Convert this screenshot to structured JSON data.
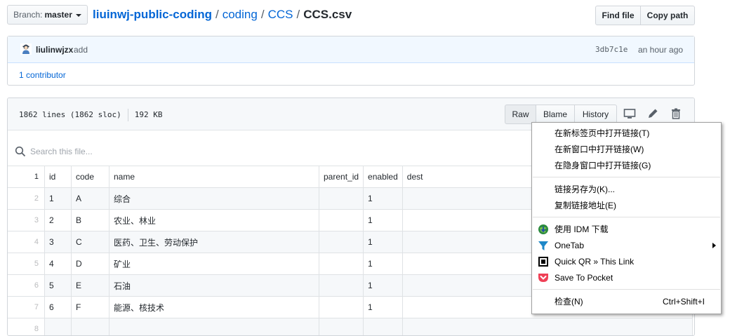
{
  "header": {
    "branch_label": "Branch:",
    "branch_value": "master",
    "breadcrumb": {
      "repo": "liuinwj-public-coding",
      "sep": "/",
      "dir1": "coding",
      "dir2": "CCS",
      "file": "CCS.csv"
    },
    "find_file": "Find file",
    "copy_path": "Copy path"
  },
  "commit": {
    "author": "liulinwjzx",
    "message": "add",
    "sha": "3db7c1e",
    "time": "an hour ago",
    "contributors_count": "1",
    "contributors_label": "contributor"
  },
  "file": {
    "lines": "1862 lines (1862 sloc)",
    "size": "192 KB",
    "raw": "Raw",
    "blame": "Blame",
    "history": "History",
    "search_placeholder": "Search this file..."
  },
  "table": {
    "headers": [
      "id",
      "code",
      "name",
      "parent_id",
      "enabled",
      "dest"
    ],
    "rows": [
      {
        "ln": "2",
        "cells": [
          "1",
          "A",
          "综合",
          "",
          "1",
          ""
        ]
      },
      {
        "ln": "3",
        "cells": [
          "2",
          "B",
          "农业、林业",
          "",
          "1",
          ""
        ]
      },
      {
        "ln": "4",
        "cells": [
          "3",
          "C",
          "医药、卫生、劳动保护",
          "",
          "1",
          ""
        ]
      },
      {
        "ln": "5",
        "cells": [
          "4",
          "D",
          "矿业",
          "",
          "1",
          ""
        ]
      },
      {
        "ln": "6",
        "cells": [
          "5",
          "E",
          "石油",
          "",
          "1",
          ""
        ]
      },
      {
        "ln": "7",
        "cells": [
          "6",
          "F",
          "能源、核技术",
          "",
          "1",
          ""
        ]
      },
      {
        "ln": "8",
        "cells": [
          "",
          "",
          "",
          "",
          "",
          ""
        ]
      }
    ]
  },
  "context_menu": {
    "open_new_tab": "在新标签页中打开链接(T)",
    "open_new_window": "在新窗口中打开链接(W)",
    "open_incognito": "在隐身窗口中打开链接(G)",
    "save_link_as": "链接另存为(K)...",
    "copy_link": "复制链接地址(E)",
    "idm": "使用 IDM 下载",
    "onetab": "OneTab",
    "quickqr": "Quick QR » This Link",
    "pocket": "Save To Pocket",
    "inspect": "检查(N)",
    "inspect_shortcut": "Ctrl+Shift+I"
  }
}
